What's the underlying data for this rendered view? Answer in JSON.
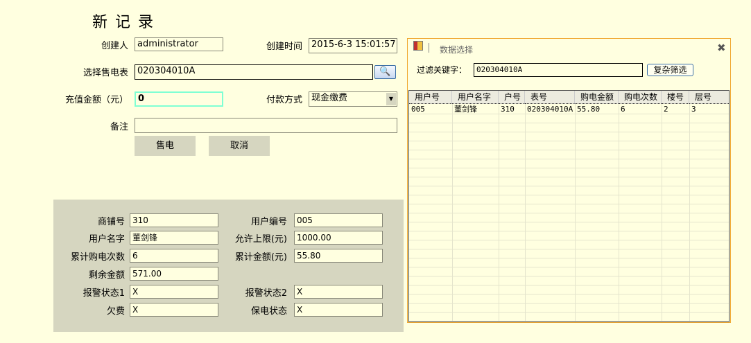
{
  "form": {
    "title": "新 记 录",
    "creator_label": "创建人",
    "creator": "administrator",
    "time_label": "创建时间",
    "time": "2015-6-3 15:01:57",
    "meter_label": "选择售电表",
    "meter": "020304010A",
    "amount_label": "充值金额（元）",
    "amount": "0",
    "pay_label": "付款方式",
    "pay": "现金缴费",
    "note_label": "备注",
    "note": "",
    "sell_button": "售电",
    "cancel_button": "取消"
  },
  "info": {
    "shop_label": "商铺号",
    "shop": "310",
    "uid_label": "用户编号",
    "uid": "005",
    "name_label": "用户名字",
    "name": "董剑锋",
    "limit_label": "允许上限(元)",
    "limit": "1000.00",
    "count_label": "累计购电次数",
    "count": "6",
    "total_label": "累计金额(元)",
    "total": "55.80",
    "remain_label": "剩余金额",
    "remain": "571.00",
    "alarm1_label": "报警状态1",
    "alarm1": "X",
    "alarm2_label": "报警状态2",
    "alarm2": "X",
    "owe_label": "欠费",
    "owe": "X",
    "keep_label": "保电状态",
    "keep": "X"
  },
  "selector": {
    "title": "数据选择",
    "filter_label": "过滤关键字：",
    "filter": "020304010A",
    "advanced_button": "复杂筛选",
    "columns": [
      "用户号",
      "用户名字",
      "户号",
      "表号",
      "购电金额",
      "购电次数",
      "楼号",
      "层号"
    ],
    "rows": [
      [
        "005",
        "董剑锋",
        "310",
        "020304010A",
        "55.80",
        "6",
        "2",
        "3"
      ]
    ]
  },
  "colors": {
    "background": "#ffffe0",
    "panel": "#d6d6c0",
    "border_accent": "#f0a830",
    "focus": "#7fffd4"
  }
}
